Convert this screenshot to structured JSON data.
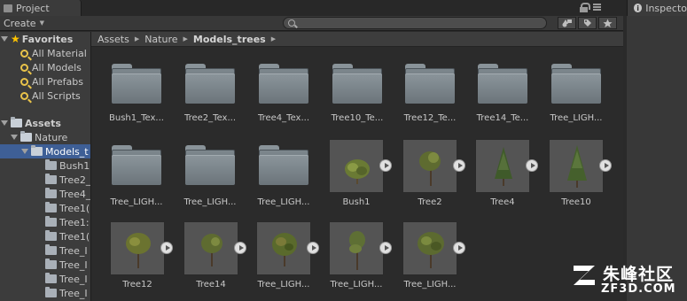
{
  "tabs": {
    "project": "Project",
    "inspector": "Inspecto"
  },
  "toolbar": {
    "create": "Create",
    "search_placeholder": ""
  },
  "tree": {
    "favorites": "Favorites",
    "favorites_items": [
      "All Material",
      "All Models",
      "All Prefabs",
      "All Scripts"
    ],
    "assets": "Assets",
    "nature": "Nature",
    "models_trees": "Models_t",
    "children": [
      "Bush1",
      "Tree2_",
      "Tree4_",
      "Tree1(",
      "Tree1:",
      "Tree1(",
      "Tree_I",
      "Tree_I",
      "Tree_I",
      "Tree_I"
    ]
  },
  "breadcrumb": {
    "root": "Assets",
    "mid": "Nature",
    "current": "Models_trees"
  },
  "folders": [
    "Bush1_Tex...",
    "Tree2_Tex...",
    "Tree4_Tex...",
    "Tree10_Te...",
    "Tree12_Te...",
    "Tree14_Te...",
    "Tree_LIGH...",
    "Tree_LIGH...",
    "Tree_LIGH...",
    "Tree_LIGH..."
  ],
  "models": [
    "Bush1",
    "Tree2",
    "Tree4",
    "Tree10",
    "Tree12",
    "Tree14",
    "Tree_LIGH...",
    "Tree_LIGH...",
    "Tree_LIGH..."
  ],
  "watermark": {
    "title": "朱峰社区",
    "sub": "ZF3D.COM"
  }
}
